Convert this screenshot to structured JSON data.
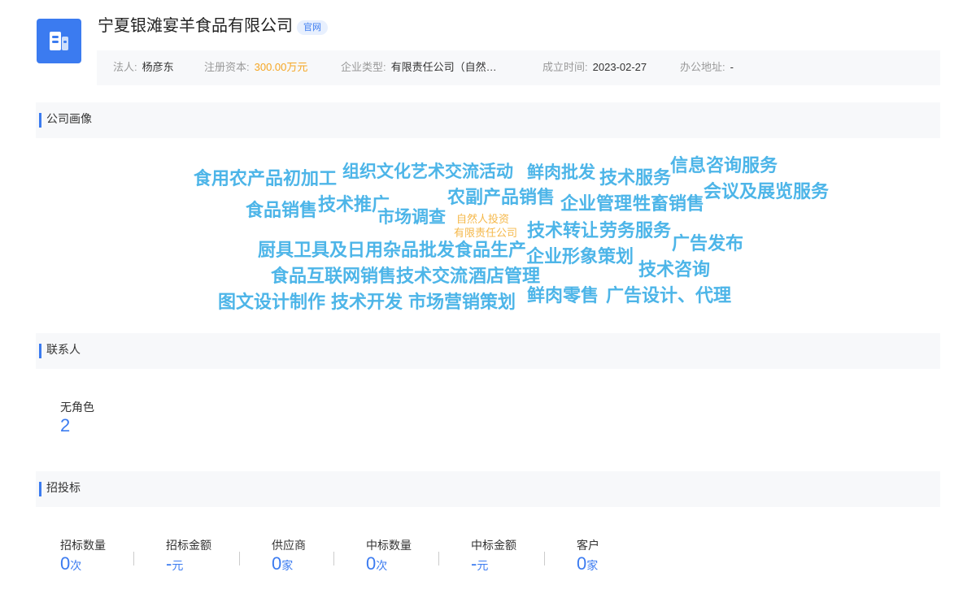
{
  "company": {
    "name": "宁夏银滩宴羊食品有限公司",
    "website_badge": "官网",
    "accent_color": "#3b7bf0"
  },
  "info": {
    "legal_person_label": "法人:",
    "legal_person": "杨彦东",
    "capital_label": "注册资本:",
    "capital": "300.00万元",
    "type_label": "企业类型:",
    "type": "有限责任公司（自然…",
    "founded_label": "成立时间:",
    "founded": "2023-02-27",
    "address_label": "办公地址:",
    "address": "-"
  },
  "portrait": {
    "title": "公司画像",
    "tags": [
      "食用农产品初加工",
      "组织文化艺术交流活动",
      "鲜肉批发",
      "技术服务",
      "信息咨询服务",
      "会议及展览服务",
      "食品销售",
      "技术推广",
      "农副产品销售",
      "企业管理",
      "牲畜销售",
      "市场调查",
      "自然人投资",
      "有限责任公司",
      "技术转让",
      "劳务服务",
      "广告发布",
      "厨具卫具及日用杂品批发",
      "食品生产",
      "企业形象策划",
      "技术咨询",
      "食品互联网销售",
      "技术交流",
      "酒店管理",
      "图文设计制作",
      "技术开发",
      "市场营销策划",
      "鲜肉零售",
      "广告设计、代理"
    ]
  },
  "contacts": {
    "title": "联系人",
    "no_role_label": "无角色",
    "no_role_count": "2"
  },
  "bidding": {
    "title": "招投标",
    "stats": [
      {
        "label": "招标数量",
        "value": "0",
        "unit": "次"
      },
      {
        "label": "招标金额",
        "value": "-",
        "unit": "元"
      },
      {
        "label": "供应商",
        "value": "0",
        "unit": "家"
      },
      {
        "label": "中标数量",
        "value": "0",
        "unit": "次"
      },
      {
        "label": "中标金额",
        "value": "-",
        "unit": "元"
      },
      {
        "label": "客户",
        "value": "0",
        "unit": "家"
      }
    ]
  }
}
